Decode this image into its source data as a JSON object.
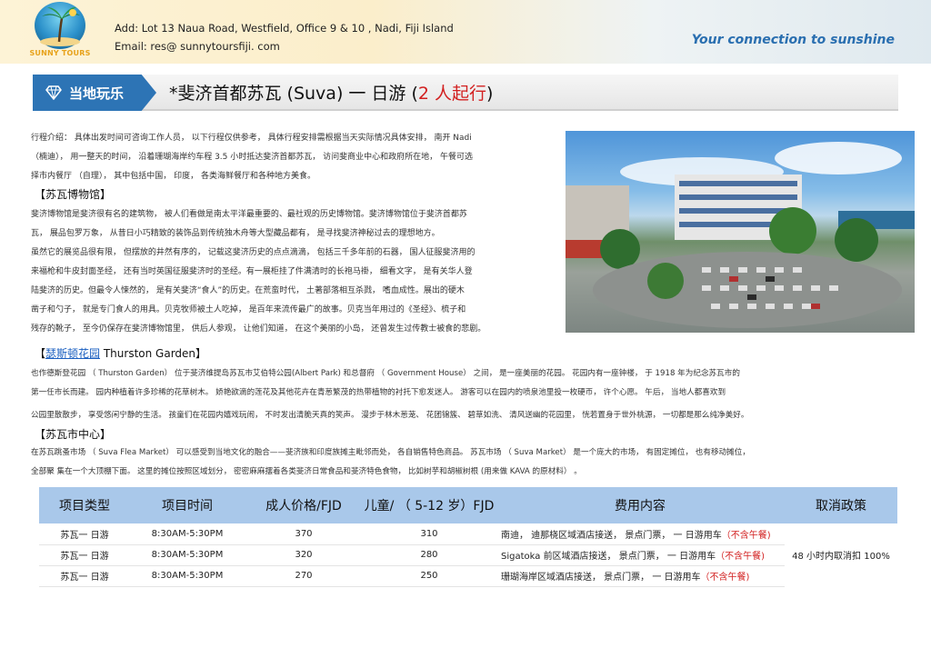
{
  "header": {
    "logo_text": "SUNNY TOURS",
    "address": "Add:  Lot 13  Naua  Road,  Westfield,  Office 9 &  10 ,  Nadi,  Fiji Island",
    "email": "Email:   res@ sunnytoursfiji. com",
    "tagline": "Your  connection  to  sunshine"
  },
  "title_band": {
    "tag_label": "当地玩乐",
    "title_main": "*斐济首都苏瓦  (Suva)  一 日游  (",
    "title_red": "2  人起行",
    "title_end": ")"
  },
  "intro": {
    "lines": [
      "行程介绍：    具体出发时间可咨询工作人员，    以下行程仅供参考，    具体行程安排需根据当天实际情况具体安排，    南开 Nadi",
      "（楠迪），  用一整天的时间，   沿着珊瑚海岸约车程  3.5 小时抵达斐济首都苏瓦，    访问斐商业中心和政府所在地，    午餐可选",
      "择市内餐厅  （自理），    其中包括中国，   印度，  各类海鲜餐厅和各种地方美食。"
    ]
  },
  "museum": {
    "heading": "【苏瓦博物馆】",
    "lines": [
      "斐济博物馆是斐济很有名的建筑物，    被人们看做是南太平洋最重要的、最社观的历史博物馆。斐济博物馆位于斐济首都苏",
      "瓦，    展品包罗万象，   从昔日小巧精致的装饰品到传统独木舟等大型藏品都有，    是寻找斐济神秘过去的理想地方。",
      "虽然它的展览品很有限，    但摆放的井然有序的，    记载这斐济历史的点点滴滴，    包括三千多年前的石器，    国人征服斐济用的",
      "来福枪和牛皮封面圣经，    还有当时英国征服斐济时的圣经。有一展柜挂了件满清时的长袍马褂，   细看文字，    是有关华人登",
      "陆斐济的历史。但最令人悚然的，    是有关斐济“食人”的历史。在荒蛮时代，    土著部落相互杀戮，    嗜血成性。展出的硬木",
      "凿子和勺子，    就是专门食人的用具。贝克牧师被土人吃掉，    是百年来流传最广的故事。贝克当年用过的《圣经》、梳子和",
      "残存的靴子，    至今仍保存在斐济博物馆里，    供后人参观，    让他们知道，    在这个美丽的小岛，    还曾发生过传教士被食的悲剧。"
    ]
  },
  "garden": {
    "heading_pre": "【",
    "heading_link": "瑟斯顿花园",
    "heading_post": " Thurston Garden】",
    "lines": [
      "也作德斯登花园  （ Thurston  Garden）  位于斐济维提岛苏瓦市艾伯特公园(Albert  Park)  和总督府  （ Government  House）  之间，    是一座美丽的花园。    花园内有一座钟楼，      于  1918  年为纪念苏瓦市的",
      "第一任市长而建。    园内种植着许多珍稀的花草树木。    娇艳欲滴的莲花及其他花卉在青葱繁茂的热带植物的衬托下愈发迷人。    游客可以在园内的喷泉池里投一枚硬币，    许个心愿。    午后，    当地人都喜欢到",
      "公园里散散步，    享受悠闲宁静的生活。    孩童们在花园内嬉戏玩闹，    不时发出清脆天真的笑声。    漫步于林木葱茏、    花团锦簇、    碧草如洗、    清风送幽的花园里，    恍若置身于世外桃源，    一切都是那么纯净美好。"
    ]
  },
  "center": {
    "heading": "【苏瓦市中心】",
    "lines": [
      "在苏瓦跳蚤市场  （ Suva Flea Market）  可以感受到当地文化的融合——斐济族和印度族摊主毗邻而处，    各自销售特色商品。    苏瓦市场  （ Suva  Market）  是一个庞大的市场，    有固定摊位，    也有移动摊位，",
      "全部聚 集在一个大顶棚下面。    这里的摊位按照区域划分，    密密麻麻摆着各类斐济日常食品和斐济特色食物，    比如树芋和胡椒树根  (用来做   KAVA   的原材料）  。"
    ]
  },
  "table": {
    "headers": [
      "项目类型",
      "项目时间",
      "成人价格/FJD",
      "儿童/  （ 5-12 岁）FJD",
      "费用内容",
      "取消政策"
    ],
    "rows": [
      {
        "type": "苏瓦一 日游",
        "time": "8:30AM-5:30PM",
        "adult": "370",
        "child": "310",
        "fee": "南迪，    迪那桡区域酒店接送，    景点门票，    一 日游用车",
        "fee_note": "（不含午餐)"
      },
      {
        "type": "苏瓦一 日游",
        "time": "8:30AM-5:30PM",
        "adult": "320",
        "child": "280",
        "fee": "Sigatoka 前区域酒店接送，     景点门票，    一 日游用车",
        "fee_note": "（不含午餐)"
      },
      {
        "type": "苏瓦一 日游",
        "time": "8:30AM-5:30PM",
        "adult": "270",
        "child": "250",
        "fee": " 珊瑚海岸区域酒店接送，    景点门票，    一 日游用车",
        "fee_note": "（不含午餐)"
      }
    ],
    "policy": "48  小时内取消扣  100%"
  },
  "colors": {
    "accent_blue": "#2d74b5",
    "table_header": "#a9c8ea",
    "note_red": "#d21f1f"
  }
}
